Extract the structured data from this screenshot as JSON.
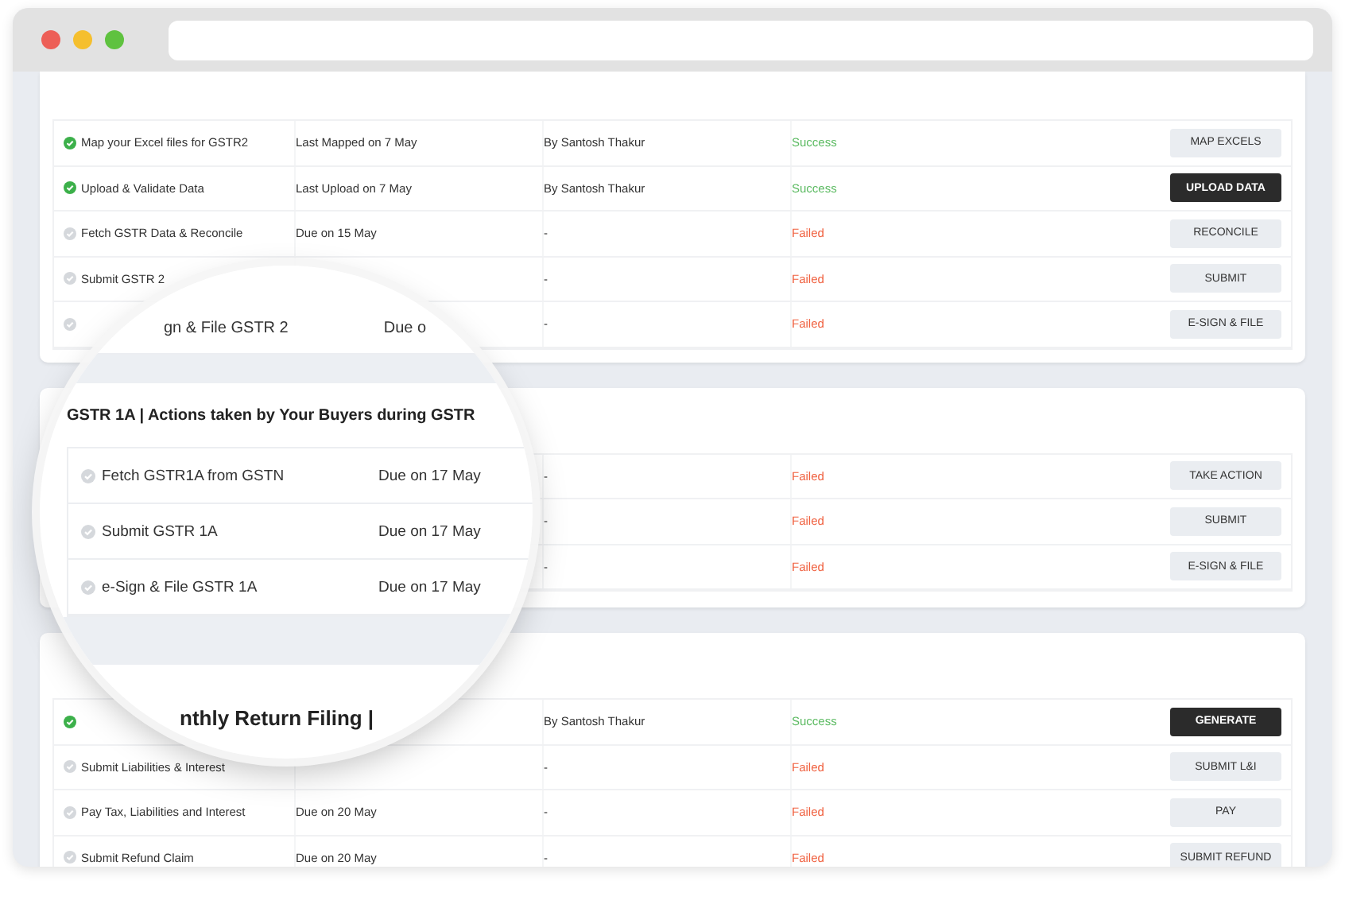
{
  "sections": [
    {
      "rows": [
        {
          "name": "Map your Excel files for GSTR2",
          "due": "Last Mapped on 7 May",
          "by": "By Santosh Thakur",
          "status": "Success",
          "success": true,
          "completed": true,
          "button": "MAP EXCELS",
          "highlighted": false
        },
        {
          "name": "Upload & Validate Data",
          "due": "Last Upload on 7 May",
          "by": "By Santosh Thakur",
          "status": "Success",
          "success": true,
          "completed": true,
          "button": "UPLOAD DATA",
          "highlighted": true
        },
        {
          "name": "Fetch GSTR Data & Reconcile",
          "due": "Due on 15 May",
          "by": "-",
          "status": "Failed",
          "success": false,
          "completed": false,
          "button": "RECONCILE",
          "highlighted": false
        },
        {
          "name": "Submit GSTR 2",
          "by": "-",
          "status": "Failed",
          "success": false,
          "completed": false,
          "button": "SUBMIT",
          "highlighted": false
        },
        {
          "by": "-",
          "status": "Failed",
          "success": false,
          "completed": false,
          "button": "E-SIGN & FILE",
          "highlighted": false
        }
      ]
    },
    {
      "rows": [
        {
          "by": "-",
          "status": "Failed",
          "success": false,
          "button": "TAKE ACTION",
          "highlighted": false
        },
        {
          "by": "-",
          "status": "Failed",
          "success": false,
          "button": "SUBMIT",
          "highlighted": false
        },
        {
          "by": "-",
          "status": "Failed",
          "success": false,
          "button": "E-SIGN & FILE",
          "highlighted": false
        }
      ]
    },
    {
      "rows": [
        {
          "by": "By Santosh Thakur",
          "status": "Success",
          "success": true,
          "completed": true,
          "button": "GENERATE",
          "highlighted": true
        },
        {
          "name": "Submit Liabilities & Interest",
          "by": "-",
          "status": "Failed",
          "success": false,
          "completed": false,
          "button": "SUBMIT L&I",
          "highlighted": false
        },
        {
          "name": "Pay Tax, Liabilities and Interest",
          "due": "Due on 20 May",
          "by": "-",
          "status": "Failed",
          "success": false,
          "completed": false,
          "button": "PAY",
          "highlighted": false
        },
        {
          "name": "Submit Refund Claim",
          "due": "Due on 20 May",
          "by": "-",
          "status": "Failed",
          "success": false,
          "completed": false,
          "button": "SUBMIT REFUND",
          "highlighted": false
        }
      ]
    }
  ],
  "magnifier": {
    "top_row": {
      "name": "gn & File GSTR 2",
      "due": "Due o"
    },
    "title": "GSTR 1A | Actions taken by Your Buyers during GSTR",
    "rows": [
      {
        "name": "Fetch GSTR1A from GSTN",
        "due": "Due on 17 May",
        "completed": false
      },
      {
        "name": "Submit GSTR 1A",
        "due": "Due on 17 May",
        "completed": false
      },
      {
        "name": "e-Sign & File GSTR 1A",
        "due": "Due on 17 May",
        "completed": false
      }
    ],
    "bottom_text": "nthly Return Filing |"
  }
}
